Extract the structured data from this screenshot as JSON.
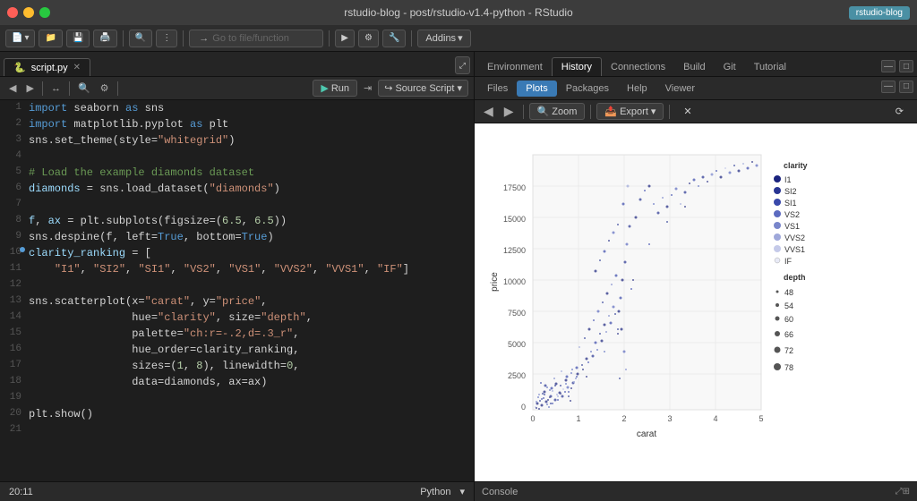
{
  "titleBar": {
    "title": "rstudio-blog - post/rstudio-v1.4-python - RStudio",
    "userBadge": "rstudio-blog"
  },
  "toolbar": {
    "gotoPlaceholder": "Go to file/function",
    "addins": "Addins"
  },
  "editorTabs": [
    {
      "label": "script.py",
      "active": true
    }
  ],
  "editorToolbar": {
    "runLabel": "Run",
    "sourceLabel": "Source Script"
  },
  "codeLines": [
    {
      "num": 1,
      "text": "import seaborn as sns"
    },
    {
      "num": 2,
      "text": "import matplotlib.pyplot as plt"
    },
    {
      "num": 3,
      "text": "sns.set_theme(style=\"whitegrid\")"
    },
    {
      "num": 4,
      "text": ""
    },
    {
      "num": 5,
      "text": "# Load the example diamonds dataset"
    },
    {
      "num": 6,
      "text": "diamonds = sns.load_dataset(\"diamonds\")"
    },
    {
      "num": 7,
      "text": ""
    },
    {
      "num": 8,
      "text": "f, ax = plt.subplots(figsize=(6.5, 6.5))"
    },
    {
      "num": 9,
      "text": "sns.despine(f, left=True, bottom=True)"
    },
    {
      "num": 10,
      "text": "clarity_ranking = ["
    },
    {
      "num": 11,
      "text": "    \"I1\", \"SI2\", \"SI1\", \"VS2\", \"VS1\", \"VVS2\", \"VVS1\", \"IF\"]"
    },
    {
      "num": 12,
      "text": ""
    },
    {
      "num": 13,
      "text": "sns.scatterplot(x=\"carat\", y=\"price\","
    },
    {
      "num": 14,
      "text": "                hue=\"clarity\", size=\"depth\","
    },
    {
      "num": 15,
      "text": "                palette=\"ch:r=-.2,d=.3_r\","
    },
    {
      "num": 16,
      "text": "                hue_order=clarity_ranking,"
    },
    {
      "num": 17,
      "text": "                sizes=(1, 8), linewidth=0,"
    },
    {
      "num": 18,
      "text": "                data=diamonds, ax=ax)"
    },
    {
      "num": 19,
      "text": ""
    },
    {
      "num": 20,
      "text": "plt.show()"
    },
    {
      "num": 21,
      "text": ""
    }
  ],
  "statusBar": {
    "position": "20:11",
    "language": "Python"
  },
  "bottomLeft": {
    "console": "Console"
  },
  "rightTopTabs": [
    {
      "label": "Environment",
      "active": false
    },
    {
      "label": "History",
      "active": true
    },
    {
      "label": "Connections",
      "active": false
    },
    {
      "label": "Build",
      "active": false
    },
    {
      "label": "Git",
      "active": false
    },
    {
      "label": "Tutorial",
      "active": false
    }
  ],
  "rightSecondTabs": [
    {
      "label": "Files",
      "active": false
    },
    {
      "label": "Plots",
      "active": true
    },
    {
      "label": "Packages",
      "active": false
    },
    {
      "label": "Help",
      "active": false
    },
    {
      "label": "Viewer",
      "active": false
    }
  ],
  "plotToolbar": {
    "zoomLabel": "Zoom",
    "exportLabel": "Export"
  },
  "plot": {
    "xLabel": "carat",
    "yLabel": "price",
    "xTicks": [
      "0",
      "1",
      "2",
      "3",
      "4",
      "5"
    ],
    "yTicks": [
      "0",
      "2500",
      "5000",
      "7500",
      "10000",
      "12500",
      "15000",
      "17500"
    ],
    "legendTitle1": "clarity",
    "legendItems1": [
      {
        "label": "I1",
        "color": "#1a237e"
      },
      {
        "label": "SI2",
        "color": "#283593"
      },
      {
        "label": "SI1",
        "color": "#3949ab"
      },
      {
        "label": "VS2",
        "color": "#5c6bc0"
      },
      {
        "label": "VS1",
        "color": "#7986cb"
      },
      {
        "label": "VVS2",
        "color": "#9fa8da"
      },
      {
        "label": "VVS1",
        "color": "#c5cae9"
      },
      {
        "label": "IF",
        "color": "#e8eaf6"
      }
    ],
    "legendTitle2": "depth",
    "legendItems2": [
      {
        "label": "48"
      },
      {
        "label": "54"
      },
      {
        "label": "60"
      },
      {
        "label": "66"
      },
      {
        "label": "72"
      },
      {
        "label": "78"
      }
    ]
  }
}
